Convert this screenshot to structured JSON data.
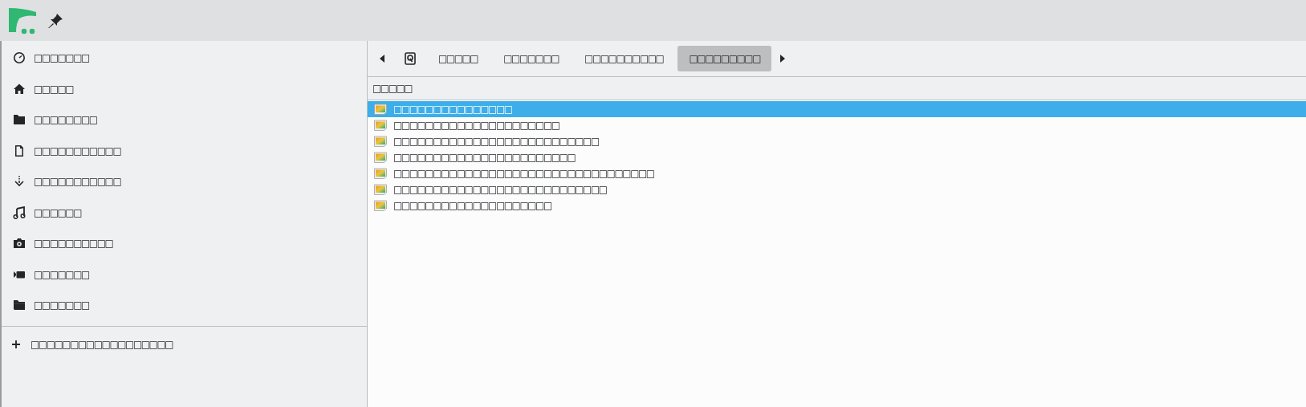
{
  "sidebar": {
    "items": [
      {
        "kind": "recent",
        "label": "□□□□□□□"
      },
      {
        "kind": "home",
        "label": "□□□□□"
      },
      {
        "kind": "folder",
        "label": "□□□□□□□□"
      },
      {
        "kind": "document",
        "label": "□□□□□□□□□□□"
      },
      {
        "kind": "download",
        "label": "□□□□□□□□□□□"
      },
      {
        "kind": "music",
        "label": "□□□□□□"
      },
      {
        "kind": "camera",
        "label": "□□□□□□□□□□"
      },
      {
        "kind": "video",
        "label": "□□□□□□□"
      },
      {
        "kind": "folder-open",
        "label": "□□□□□□□"
      }
    ],
    "add_label": "□□□□□□□□□□□□□□□□□□"
  },
  "breadcrumb": [
    {
      "label": "□□□□□",
      "selected": false
    },
    {
      "label": "□□□□□□□",
      "selected": false
    },
    {
      "label": "□□□□□□□□□□",
      "selected": false
    },
    {
      "label": "□□□□□□□□□",
      "selected": true
    }
  ],
  "list": {
    "column": "□□□□□",
    "rows": [
      {
        "label": "□□□□□□□□□□□□□□□",
        "selected": true
      },
      {
        "label": "□□□□□□□□□□□□□□□□□□□□□",
        "selected": false
      },
      {
        "label": "□□□□□□□□□□□□□□□□□□□□□□□□□□",
        "selected": false
      },
      {
        "label": "□□□□□□□□□□□□□□□□□□□□□□□",
        "selected": false
      },
      {
        "label": "□□□□□□□□□□□□□□□□□□□□□□□□□□□□□□□□□",
        "selected": false
      },
      {
        "label": "□□□□□□□□□□□□□□□□□□□□□□□□□□□",
        "selected": false
      },
      {
        "label": "□□□□□□□□□□□□□□□□□□□□",
        "selected": false
      }
    ]
  }
}
